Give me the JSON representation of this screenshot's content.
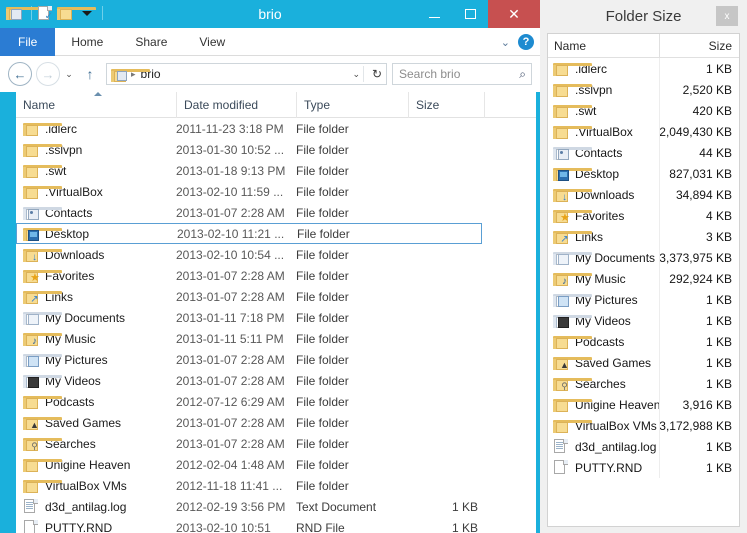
{
  "explorer": {
    "title": "brio",
    "quick_access": [
      {
        "name": "user-folder-icon",
        "label": "Properties / user folder"
      },
      {
        "name": "properties-icon",
        "label": "Properties"
      },
      {
        "name": "new-folder-icon",
        "label": "New folder"
      },
      {
        "name": "customize-qat-icon",
        "label": "Customize Quick Access Toolbar"
      }
    ],
    "window_controls": {
      "minimize": "–",
      "maximize": "❐",
      "close": "✕"
    },
    "ribbon_tabs": [
      {
        "label": "File",
        "active": true
      },
      {
        "label": "Home",
        "active": false
      },
      {
        "label": "Share",
        "active": false
      },
      {
        "label": "View",
        "active": false
      }
    ],
    "ribbon_right": {
      "expand_label": "⌄",
      "help_label": "?"
    },
    "nav": {
      "back": "←",
      "forward": "→",
      "recent_locations": "⌄",
      "up": "↑"
    },
    "address": {
      "crumb_separator": "▸",
      "path": "brio",
      "dropdown": "⌄",
      "refresh": "↻"
    },
    "search": {
      "placeholder": "Search brio",
      "icon": "⌕"
    },
    "columns": [
      {
        "label": "Name",
        "sorted": "asc"
      },
      {
        "label": "Date modified"
      },
      {
        "label": "Type"
      },
      {
        "label": "Size"
      }
    ],
    "rows": [
      {
        "name": ".idlerc",
        "date": "2011-11-23 3:18 PM",
        "type": "File folder",
        "size": "",
        "icon": "folder",
        "selected": false
      },
      {
        "name": ".sslvpn",
        "date": "2013-01-30 10:52 ...",
        "type": "File folder",
        "size": "",
        "icon": "folder",
        "selected": false
      },
      {
        "name": ".swt",
        "date": "2013-01-18 9:13 PM",
        "type": "File folder",
        "size": "",
        "icon": "folder",
        "selected": false
      },
      {
        "name": ".VirtualBox",
        "date": "2013-02-10 11:59 ...",
        "type": "File folder",
        "size": "",
        "icon": "folder",
        "selected": false
      },
      {
        "name": "Contacts",
        "date": "2013-01-07 2:28 AM",
        "type": "File folder",
        "size": "",
        "icon": "contacts",
        "selected": false
      },
      {
        "name": "Desktop",
        "date": "2013-02-10 11:21 ...",
        "type": "File folder",
        "size": "",
        "icon": "desktop",
        "selected": true
      },
      {
        "name": "Downloads",
        "date": "2013-02-10 10:54 ...",
        "type": "File folder",
        "size": "",
        "icon": "downloads",
        "selected": false
      },
      {
        "name": "Favorites",
        "date": "2013-01-07 2:28 AM",
        "type": "File folder",
        "size": "",
        "icon": "favorites",
        "selected": false
      },
      {
        "name": "Links",
        "date": "2013-01-07 2:28 AM",
        "type": "File folder",
        "size": "",
        "icon": "links",
        "selected": false
      },
      {
        "name": "My Documents",
        "date": "2013-01-11 7:18 PM",
        "type": "File folder",
        "size": "",
        "icon": "documents",
        "selected": false
      },
      {
        "name": "My Music",
        "date": "2013-01-11 5:11 PM",
        "type": "File folder",
        "size": "",
        "icon": "music",
        "selected": false
      },
      {
        "name": "My Pictures",
        "date": "2013-01-07 2:28 AM",
        "type": "File folder",
        "size": "",
        "icon": "pictures",
        "selected": false
      },
      {
        "name": "My Videos",
        "date": "2013-01-07 2:28 AM",
        "type": "File folder",
        "size": "",
        "icon": "videos",
        "selected": false
      },
      {
        "name": "Podcasts",
        "date": "2012-07-12 6:29 AM",
        "type": "File folder",
        "size": "",
        "icon": "folder",
        "selected": false
      },
      {
        "name": "Saved Games",
        "date": "2013-01-07 2:28 AM",
        "type": "File folder",
        "size": "",
        "icon": "savedgames",
        "selected": false
      },
      {
        "name": "Searches",
        "date": "2013-01-07 2:28 AM",
        "type": "File folder",
        "size": "",
        "icon": "searches",
        "selected": false
      },
      {
        "name": "Unigine Heaven",
        "date": "2012-02-04 1:48 AM",
        "type": "File folder",
        "size": "",
        "icon": "folder",
        "selected": false
      },
      {
        "name": "VirtualBox VMs",
        "date": "2012-11-18 11:41 ...",
        "type": "File folder",
        "size": "",
        "icon": "folder",
        "selected": false
      },
      {
        "name": "d3d_antilag.log",
        "date": "2012-02-19 3:56 PM",
        "type": "Text Document",
        "size": "1 KB",
        "icon": "textfile",
        "selected": false
      },
      {
        "name": "PUTTY.RND",
        "date": "2013-02-10 10:51",
        "type": "RND File",
        "size": "1 KB",
        "icon": "genericfile",
        "selected": false
      }
    ]
  },
  "folder_size": {
    "title": "Folder Size",
    "close_label": "x",
    "columns": {
      "name": "Name",
      "size": "Size"
    },
    "rows": [
      {
        "name": ".idlerc",
        "size": "1 KB",
        "icon": "folder"
      },
      {
        "name": ".sslvpn",
        "size": "2,520 KB",
        "icon": "folder"
      },
      {
        "name": ".swt",
        "size": "420 KB",
        "icon": "folder"
      },
      {
        "name": ".VirtualBox",
        "size": "2,049,430 KB",
        "icon": "folder"
      },
      {
        "name": "Contacts",
        "size": "44 KB",
        "icon": "contacts"
      },
      {
        "name": "Desktop",
        "size": "827,031 KB",
        "icon": "desktop"
      },
      {
        "name": "Downloads",
        "size": "34,894 KB",
        "icon": "downloads"
      },
      {
        "name": "Favorites",
        "size": "4 KB",
        "icon": "favorites"
      },
      {
        "name": "Links",
        "size": "3 KB",
        "icon": "links"
      },
      {
        "name": "My Documents",
        "size": "3,373,975 KB",
        "icon": "documents"
      },
      {
        "name": "My Music",
        "size": "292,924 KB",
        "icon": "music"
      },
      {
        "name": "My Pictures",
        "size": "1 KB",
        "icon": "pictures"
      },
      {
        "name": "My Videos",
        "size": "1 KB",
        "icon": "videos"
      },
      {
        "name": "Podcasts",
        "size": "1 KB",
        "icon": "folder"
      },
      {
        "name": "Saved Games",
        "size": "1 KB",
        "icon": "savedgames"
      },
      {
        "name": "Searches",
        "size": "1 KB",
        "icon": "searches"
      },
      {
        "name": "Unigine Heaven",
        "size": "3,916 KB",
        "icon": "folder"
      },
      {
        "name": "VirtualBox VMs",
        "size": "3,172,988 KB",
        "icon": "folder"
      },
      {
        "name": "d3d_antilag.log",
        "size": "1 KB",
        "icon": "textfile"
      },
      {
        "name": "PUTTY.RND",
        "size": "1 KB",
        "icon": "genericfile"
      }
    ]
  },
  "colors": {
    "title_bar": "#1ab0dc",
    "close_button": "#c75050",
    "file_tab": "#2b7cd3",
    "selection_border": "#5a9fd4",
    "panel_bg": "#f0f0f0"
  }
}
